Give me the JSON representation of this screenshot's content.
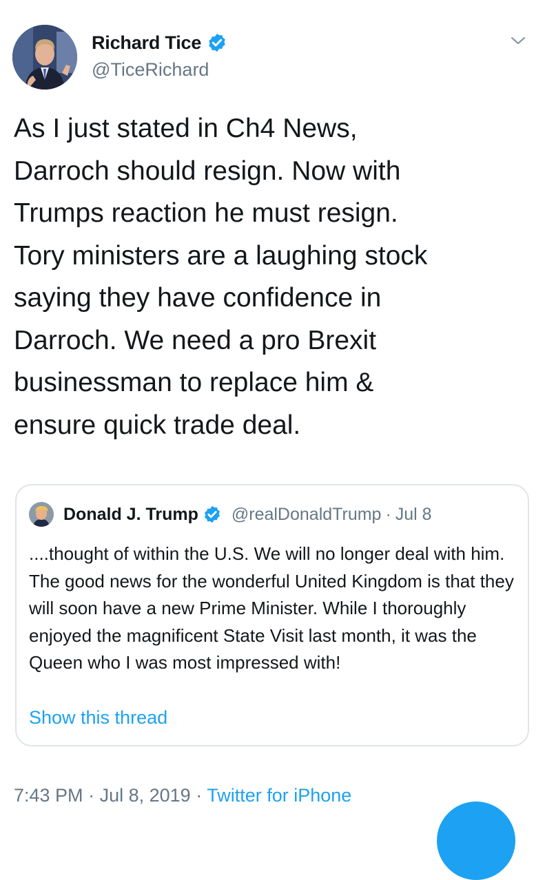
{
  "tweet": {
    "author": {
      "name": "Richard Tice",
      "handle": "@TiceRichard",
      "verified": true
    },
    "text": "As I just stated in Ch4 News,\nDarroch should resign. Now with\nTrumps reaction he must resign.\nTory ministers are a laughing stock\nsaying they have confidence in\nDarroch. We need a pro Brexit\nbusinessman to replace him &\nensure quick trade deal.",
    "menu_icon": "chevron-down-icon",
    "quoted": {
      "author": {
        "name": "Donald J. Trump",
        "handle": "@realDonaldTrump",
        "verified": true
      },
      "separator": "·",
      "date": "Jul 8",
      "text": "....thought of within the U.S. We will no longer deal with him. The good news for the wonderful United Kingdom is that they will soon have a new Prime Minister. While I thoroughly enjoyed the magnificent State Visit last month, it was the Queen who I was most impressed with!",
      "show_thread": "Show this thread"
    },
    "meta": {
      "time": "7:43 PM",
      "separator": "·",
      "date": "Jul 8, 2019",
      "source": "Twitter for iPhone"
    }
  },
  "colors": {
    "accent": "#1da1f2",
    "text": "#14171a",
    "secondary": "#657786",
    "border": "#dfe5ea"
  }
}
